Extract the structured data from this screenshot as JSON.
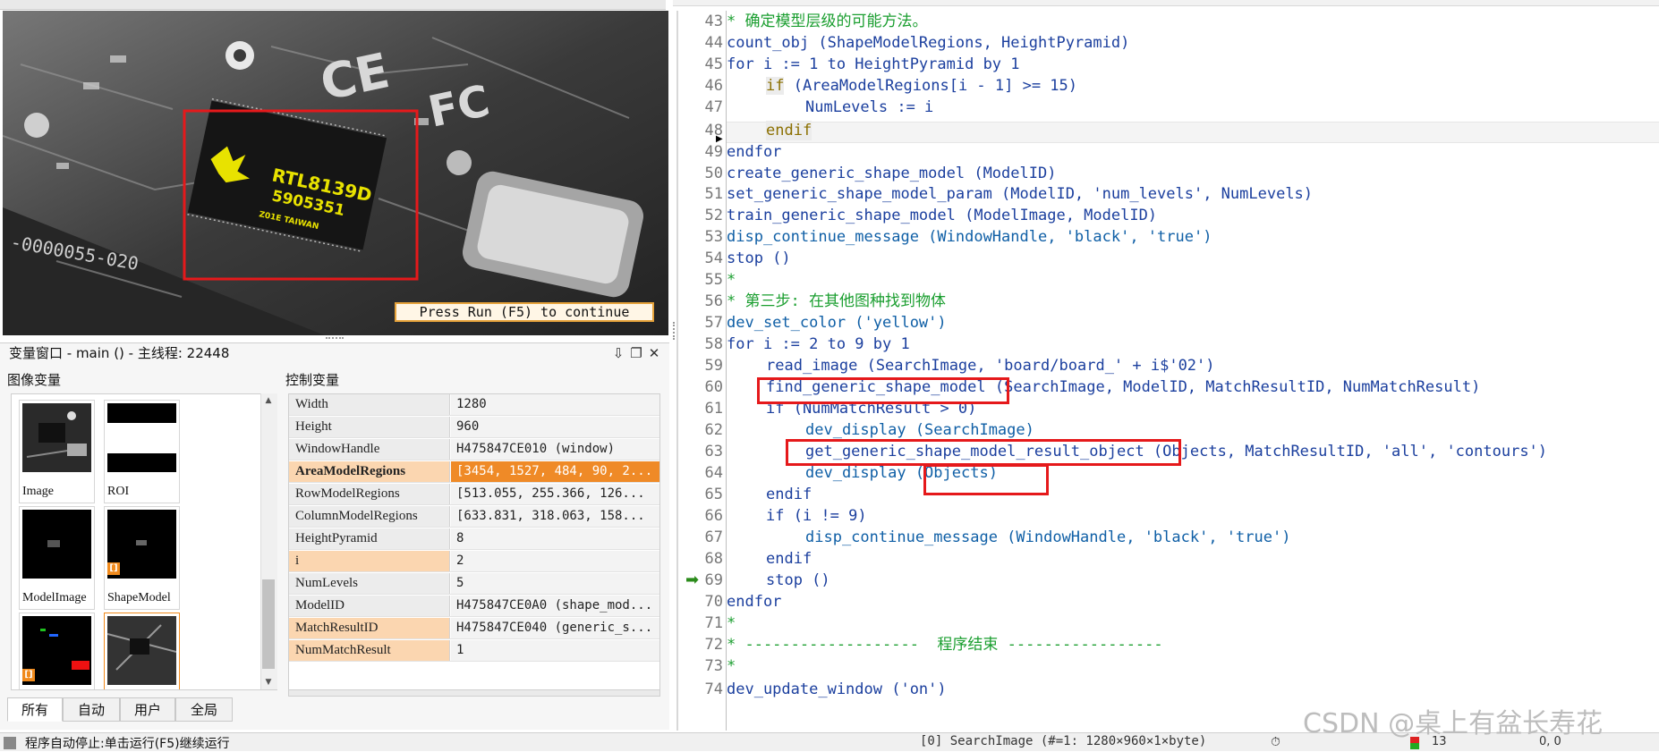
{
  "graphics": {
    "continue_message": "Press Run (F5) to continue",
    "board_text": [
      "RTL8139D",
      "5905351",
      "Z01E TAIWAN"
    ],
    "board_serial": "-0000055-020"
  },
  "var_window": {
    "title": "变量窗口 - main () - 主线程: 22448",
    "image_vars_label": "图像变量",
    "control_vars_label": "控制变量",
    "buttons": [
      "⇩",
      "❐",
      "✕"
    ],
    "image_vars": [
      {
        "name": "Image"
      },
      {
        "name": "ROI"
      },
      {
        "name": "ModelImage"
      },
      {
        "name": "ShapeModel"
      },
      {
        "name": ""
      },
      {
        "name": ""
      }
    ],
    "control_vars": [
      {
        "name": "Width",
        "value": "1280"
      },
      {
        "name": "Height",
        "value": "960"
      },
      {
        "name": "WindowHandle",
        "value": "H475847CE010 (window)"
      },
      {
        "name": "AreaModelRegions",
        "value": "[3454, 1527, 484, 90, 2..."
      },
      {
        "name": "RowModelRegions",
        "value": "[513.055, 255.366, 126..."
      },
      {
        "name": "ColumnModelRegions",
        "value": "[633.831, 318.063, 158..."
      },
      {
        "name": "HeightPyramid",
        "value": "8"
      },
      {
        "name": "i",
        "value": "2"
      },
      {
        "name": "NumLevels",
        "value": "5"
      },
      {
        "name": "ModelID",
        "value": "H475847CE0A0 (shape_mod..."
      },
      {
        "name": "MatchResultID",
        "value": "H475847CE040 (generic_s..."
      },
      {
        "name": "NumMatchResult",
        "value": "1"
      }
    ],
    "tabs": [
      "所有",
      "自动",
      "用户",
      "全局"
    ]
  },
  "status": {
    "message": "程序自动停止:单击运行(F5)继续运行",
    "image_info": "[0] SearchImage (#=1: 1280×960×1×byte)",
    "count": "13",
    "pos": "0, 0"
  },
  "code": {
    "line_numbers": [
      "43",
      "44",
      "45",
      "46",
      "47",
      "48",
      "49",
      "50",
      "51",
      "52",
      "53",
      "54",
      "55",
      "56",
      "57",
      "58",
      "59",
      "60",
      "61",
      "62",
      "63",
      "64",
      "65",
      "66",
      "67",
      "68",
      "69",
      "70",
      "71",
      "72",
      "73",
      "74"
    ],
    "lines": {
      "l43": "* 确定模型层级的可能方法。",
      "l44": "count_obj (ShapeModelRegions, HeightPyramid)",
      "l45": "for i := 1 to HeightPyramid by 1",
      "l46a": "if",
      "l46b": " (AreaModelRegions[i - 1] >= 15)",
      "l47": "NumLevels := i",
      "l48": "endif",
      "l49": "endfor",
      "l50": "create_generic_shape_model (ModelID)",
      "l51": "set_generic_shape_model_param (ModelID, 'num_levels', NumLevels)",
      "l52": "train_generic_shape_model (ModelImage, ModelID)",
      "l53": "disp_continue_message (WindowHandle, 'black', 'true')",
      "l54": "stop ()",
      "l55": "*",
      "l56": "* 第三步: 在其他图种找到物体",
      "l57": "dev_set_color ('yellow')",
      "l58": "for i := 2 to 9 by 1",
      "l59": "read_image (SearchImage, 'board/board_' + i$'02')",
      "l60": "find_generic_shape_model (SearchImage, ModelID, MatchResultID, NumMatchResult)",
      "l61": "if (NumMatchResult > 0)",
      "l62": "dev_display (SearchImage)",
      "l63": "get_generic_shape_model_result_object (Objects, MatchResultID, 'all', 'contours')",
      "l64": "dev_display (Objects)",
      "l65": "endif",
      "l66": "if (i != 9)",
      "l67": "disp_continue_message (WindowHandle, 'black', 'true')",
      "l68": "endif",
      "l69": "stop ()",
      "l70": "endfor",
      "l71": "*",
      "l72": "* -------------------  程序结束 -----------------",
      "l73": "*",
      "l74": "dev_update_window ('on')"
    }
  },
  "watermark": "CSDN @桌上有盆长寿花",
  "colors": {
    "highlight_red": "#e5191b",
    "selected_orange": "#ef8a27",
    "comment_green": "#1a9e2f",
    "code_blue": "#1b3f9e"
  }
}
